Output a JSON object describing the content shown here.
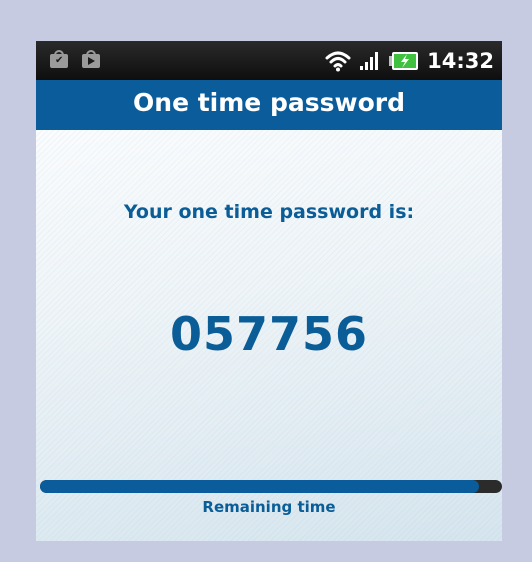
{
  "status_bar": {
    "time": "14:32",
    "left_icons": [
      "shopping-bag-check-icon",
      "shopping-bag-play-icon"
    ],
    "right_icons": [
      "wifi-icon",
      "signal-icon",
      "battery-charging-icon"
    ]
  },
  "header": {
    "title": "One time password"
  },
  "main": {
    "prompt": "Your one time password is:",
    "otp": "057756",
    "remaining_label": "Remaining time",
    "remaining_fraction": 0.95
  },
  "colors": {
    "accent": "#0a5d9a",
    "frame_background": "#c6cbe2",
    "status_bar": "#111111",
    "battery_charge": "#3fc03f"
  }
}
